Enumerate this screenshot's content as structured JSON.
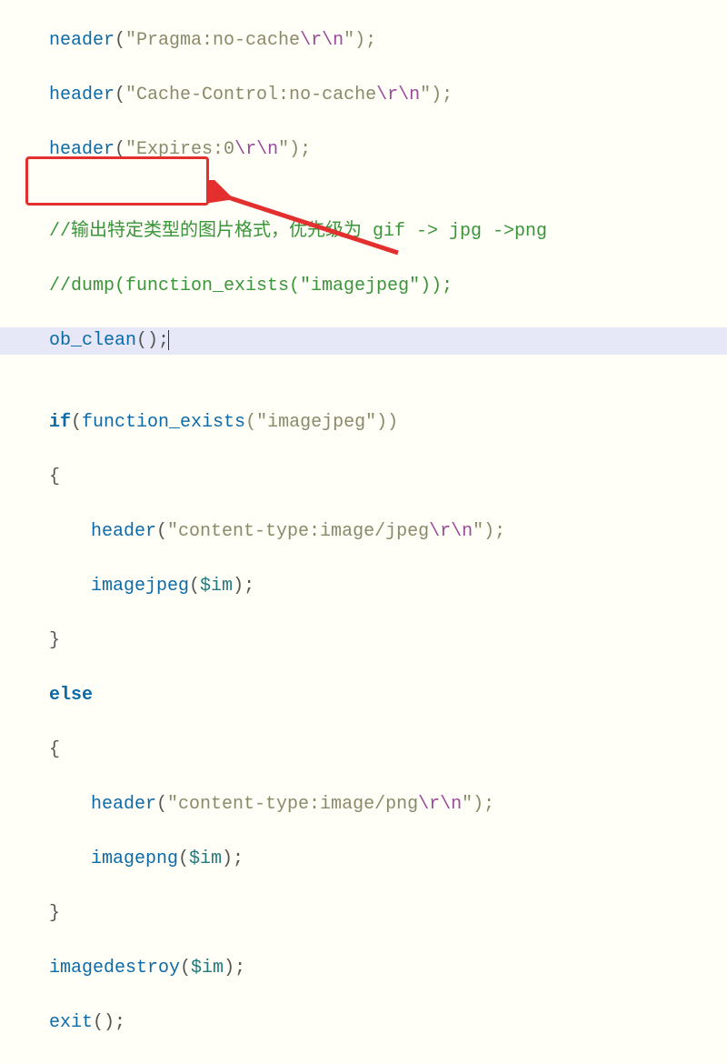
{
  "code": {
    "l1_fn": "neader",
    "l1_str": "\"Pragma:no-cache",
    "l1_esc": "\\r\\n",
    "l1_end": "\");",
    "l2_fn": "header",
    "l2_str": "\"Cache-Control:no-cache",
    "l2_esc": "\\r\\n",
    "l2_end": "\");",
    "l3_fn": "header",
    "l3_str": "\"Expires:0",
    "l3_esc": "\\r\\n",
    "l3_end": "\");",
    "blank1": "",
    "c1": "//输出特定类型的图片格式，优先级为 gif -> jpg ->png",
    "c2": "//dump(function_exists(\"imagejpeg\"));",
    "ob_fn": "ob_clean",
    "ob_par": "();",
    "blank2": "",
    "if_kw": "if",
    "if_open": "(",
    "if_fname": "function_exists",
    "if_arg": "(\"imagejpeg\"))",
    "brace_o": "{",
    "h1_fn": "header",
    "h1_str": "\"content-type:image/jpeg",
    "h1_esc": "\\r\\n",
    "h1_end": "\");",
    "ij_fn": "imagejpeg",
    "ij_open": "(",
    "ij_var": "$im",
    "ij_close": ");",
    "brace_c": "}",
    "else_kw": "else",
    "brace_o2": "{",
    "h2_fn": "header",
    "h2_str": "\"content-type:image/png",
    "h2_esc": "\\r\\n",
    "h2_end": "\");",
    "ip_fn": "imagepng",
    "ip_open": "(",
    "ip_var": "$im",
    "ip_close": ");",
    "brace_c2": "}",
    "id_fn": "imagedestroy",
    "id_open": "(",
    "id_var": "$im",
    "id_close": ");",
    "exit_fn": "exit",
    "exit_par": "();"
  },
  "annot": {
    "highlight_target": "ob_clean();",
    "box_color": "#e3302f",
    "arrow_points_to": "ob_clean-line"
  }
}
